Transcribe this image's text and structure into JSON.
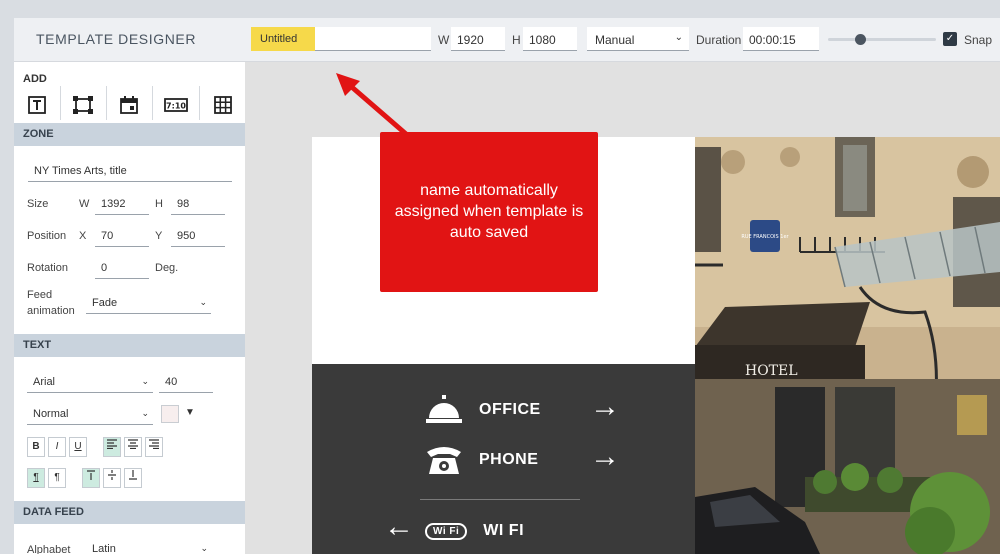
{
  "app": {
    "title": "TEMPLATE DESIGNER"
  },
  "toolbar": {
    "name_value": "Untitled",
    "width_label": "W",
    "width_value": "1920",
    "height_label": "H",
    "height_value": "1080",
    "mode_value": "Manual",
    "duration_label": "Duration",
    "duration_value": "00:00:15",
    "snap_label": "Snap",
    "snap_checked": true,
    "zoom_level": 0.25
  },
  "panel": {
    "add_title": "ADD",
    "add_tools": [
      "text-tool-icon",
      "shape-tool-icon",
      "calendar-tool-icon",
      "clock-tool-icon",
      "table-tool-icon"
    ],
    "zone": {
      "title": "ZONE",
      "name_value": "NY Times Arts, title",
      "size_label": "Size",
      "w_label": "W",
      "w_value": "1392",
      "h_label": "H",
      "h_value": "98",
      "position_label": "Position",
      "x_label": "X",
      "x_value": "70",
      "y_label": "Y",
      "y_value": "950",
      "rotation_label": "Rotation",
      "rotation_value": "0",
      "rotation_unit": "Deg.",
      "feed_label_1": "Feed",
      "feed_label_2": "animation",
      "feed_value": "Fade"
    },
    "text": {
      "title": "TEXT",
      "font_value": "Arial",
      "size_value": "40",
      "style_value": "Normal",
      "color": "#f7eeee",
      "format_buttons": [
        "B",
        "I",
        "U"
      ]
    },
    "data_feed": {
      "title": "DATA FEED",
      "alphabet_label": "Alphabet",
      "alphabet_value": "Latin"
    }
  },
  "canvas": {
    "callout_text": "name automatically assigned when template is auto saved",
    "sign": {
      "office_label": "OFFICE",
      "phone_label": "PHONE",
      "wifi_label": "WI FI",
      "wifi_badge": "Wi Fi"
    },
    "photo": {
      "hotel_sign": "HOTEL",
      "street_sign": "RUE FRANCOIS 1er"
    }
  },
  "colors": {
    "name_highlight": "#f6d94a",
    "callout": "#e11414",
    "section_header": "#c9d3dd",
    "sign_bg": "#3a3a3a"
  }
}
